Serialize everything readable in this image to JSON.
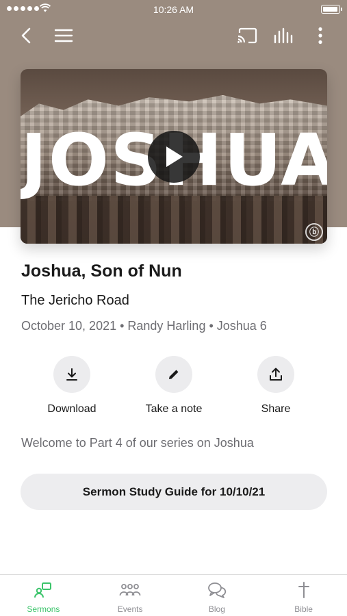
{
  "status_bar": {
    "time": "10:26 AM"
  },
  "nav": {
    "icons": [
      "back-icon",
      "menu-icon",
      "cast-icon",
      "audio-bars-icon",
      "more-vertical-icon"
    ]
  },
  "artwork": {
    "title_text": "JOSHUA",
    "logo_glyph": "ⓑ"
  },
  "sermon": {
    "title": "Joshua, Son of Nun",
    "subtitle": "The Jericho Road",
    "meta": "October 10, 2021 • Randy Harling • Joshua 6",
    "description": "Welcome to Part 4 of our series on Joshua"
  },
  "actions": [
    {
      "label": "Download",
      "icon": "download-icon"
    },
    {
      "label": "Take a note",
      "icon": "pencil-icon"
    },
    {
      "label": "Share",
      "icon": "share-icon"
    }
  ],
  "guide_button": {
    "label": "Sermon Study Guide for 10/10/21"
  },
  "tabs": [
    {
      "label": "Sermons",
      "icon": "sermons-icon",
      "active": true
    },
    {
      "label": "Events",
      "icon": "events-icon",
      "active": false
    },
    {
      "label": "Blog",
      "icon": "blog-icon",
      "active": false
    },
    {
      "label": "Bible",
      "icon": "cross-icon",
      "active": false
    }
  ],
  "colors": {
    "header_bg": "#9a8b7f",
    "accent": "#3cc46b",
    "muted": "#6d6d72",
    "button_bg": "#ececee"
  }
}
